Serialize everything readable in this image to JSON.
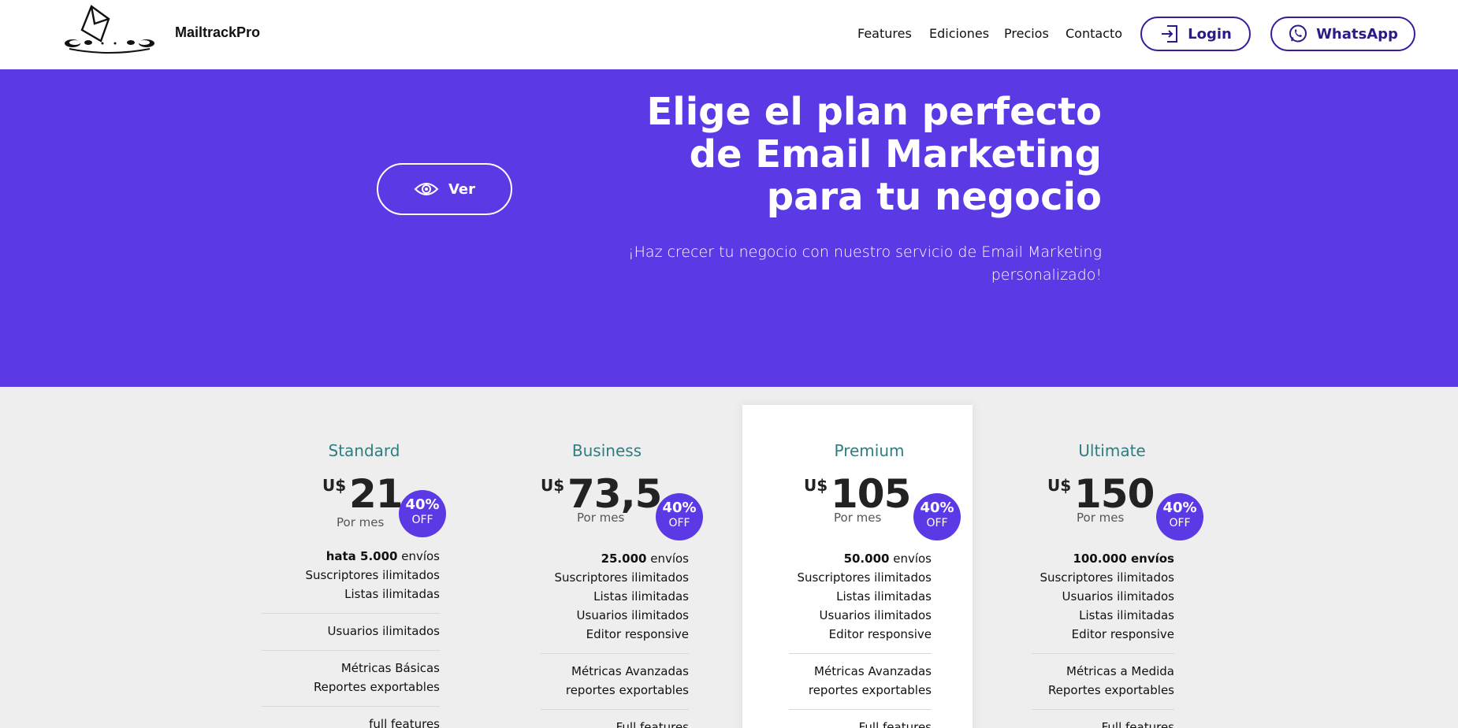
{
  "nav": {
    "brand": "MailtrackPro",
    "links": [
      "Features",
      "Ediciones",
      "Precios",
      "Contacto"
    ],
    "login_label": "Login",
    "whatsapp_label": "WhatsApp"
  },
  "hero": {
    "ver_label": "Ver",
    "title_lines": [
      "Elige el plan perfecto",
      "de Email Marketing",
      "para tu negocio"
    ],
    "subtitle_lines": [
      "¡Haz crecer tu negocio con nuestro servicio de Email Marketing",
      "personalizado!"
    ]
  },
  "plans": [
    {
      "name": "Standard",
      "currency": "U$",
      "price": "21",
      "per": "Por mes",
      "badge_pct": "40%",
      "badge_off": "OFF",
      "features_a": [
        {
          "bold": "hata 5.000",
          "rest": " envíos"
        },
        {
          "bold": "",
          "rest": "Suscriptores ilimitados"
        },
        {
          "bold": "",
          "rest": "Listas ilimitadas"
        }
      ],
      "features_b": [
        "Usuarios ilimitados"
      ],
      "features_c": [
        "Métricas Básicas",
        "Reportes exportables"
      ],
      "features_d": [
        "full features"
      ]
    },
    {
      "name": "Business",
      "currency": "U$",
      "price": "73,5",
      "per": "Por mes",
      "badge_pct": "40%",
      "badge_off": "OFF",
      "features_a": [
        {
          "bold": "25.000",
          "rest": " envíos"
        },
        {
          "bold": "",
          "rest": "Suscriptores ilimitados"
        },
        {
          "bold": "",
          "rest": "Listas ilimitadas"
        },
        {
          "bold": "",
          "rest": "Usuarios ilimitados"
        },
        {
          "bold": "",
          "rest": "Editor responsive"
        }
      ],
      "features_c": [
        "Métricas Avanzadas",
        "reportes exportables"
      ],
      "features_d": [
        "Full features"
      ]
    },
    {
      "name": "Premium",
      "currency": "U$",
      "price": "105",
      "per": "Por mes",
      "badge_pct": "40%",
      "badge_off": "OFF",
      "features_a": [
        {
          "bold": "50.000",
          "rest": " envíos"
        },
        {
          "bold": "",
          "rest": "Suscriptores ilimitados"
        },
        {
          "bold": "",
          "rest": "Listas ilimitadas"
        },
        {
          "bold": "",
          "rest": "Usuarios ilimitados"
        },
        {
          "bold": "",
          "rest": "Editor responsive"
        }
      ],
      "features_c": [
        "Métricas Avanzadas",
        "reportes exportables"
      ],
      "features_d": [
        "Full features"
      ]
    },
    {
      "name": "Ultimate",
      "currency": "U$",
      "price": "150",
      "per": "Por mes",
      "badge_pct": "40%",
      "badge_off": "OFF",
      "features_a": [
        {
          "bold": "100.000 envíos",
          "rest": ""
        },
        {
          "bold": "",
          "rest": "Suscriptores ilimitados"
        },
        {
          "bold": "",
          "rest": "Usuarios ilimitados"
        },
        {
          "bold": "",
          "rest": "Listas ilimitadas"
        },
        {
          "bold": "",
          "rest": "Editor responsive"
        }
      ],
      "features_c": [
        "Métricas a Medida",
        "Reportes exportables"
      ],
      "features_d": [
        "Full features"
      ]
    }
  ],
  "colors": {
    "primary": "#5b3ae6",
    "plan_name": "#2f7d80",
    "nav_button_border": "#3a1a9a",
    "page_bg": "#eeeeee"
  },
  "icons": {
    "logo": "envelope-logo",
    "login": "login-icon",
    "whatsapp": "whatsapp-icon",
    "ver": "eye-icon"
  }
}
